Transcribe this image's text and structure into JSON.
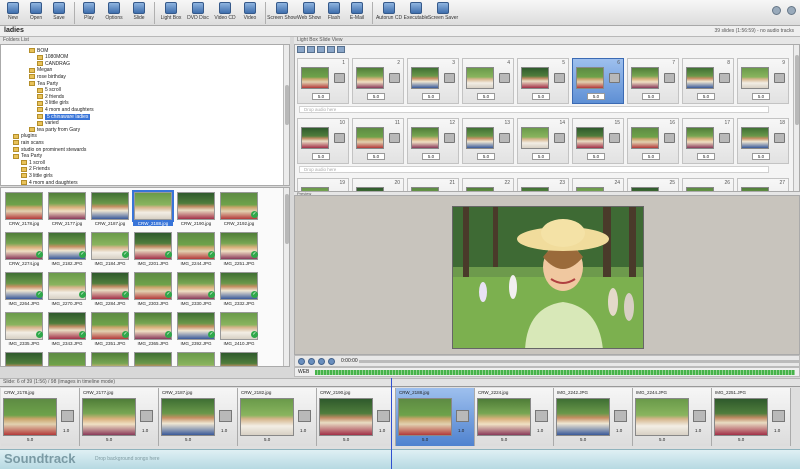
{
  "toolbar": {
    "buttons": [
      "New",
      "Open",
      "Save",
      "Play",
      "Options",
      "Slide",
      "Light Box",
      "DVD Disc",
      "Video CD",
      "Video",
      "Screen Show",
      "Web Show",
      "Flash",
      "E-Mail",
      "Autorun CD",
      "Executable",
      "Screen Saver"
    ]
  },
  "project": {
    "title": "ladies",
    "summary": "39 slides (1:56:59) - no audio tracks"
  },
  "folders": {
    "header": "Folders List",
    "items": [
      {
        "label": "BOM",
        "indent": 3
      },
      {
        "label": "1080MOM",
        "indent": 4
      },
      {
        "label": "CANDRAG",
        "indent": 4
      },
      {
        "label": "Megan",
        "indent": 3
      },
      {
        "label": "rose birthday",
        "indent": 3
      },
      {
        "label": "Tea Party",
        "indent": 3
      },
      {
        "label": "5 scroll",
        "indent": 4
      },
      {
        "label": "2 friends",
        "indent": 4
      },
      {
        "label": "3 little girls",
        "indent": 4
      },
      {
        "label": "4 mom and daughters",
        "indent": 4
      },
      {
        "label": "5 chinaware ladies",
        "indent": 4,
        "selected": true
      },
      {
        "label": "varied",
        "indent": 4
      },
      {
        "label": "tea party from Gary",
        "indent": 3
      },
      {
        "label": "plugins",
        "indent": 1
      },
      {
        "label": "rain scans",
        "indent": 1
      },
      {
        "label": "studio on prominent stewards",
        "indent": 1
      },
      {
        "label": "Tea Party",
        "indent": 1
      },
      {
        "label": "1 scroll",
        "indent": 2
      },
      {
        "label": "2 Friends",
        "indent": 2
      },
      {
        "label": "3 little girls",
        "indent": 2
      },
      {
        "label": "4 mom and daughters",
        "indent": 2
      }
    ]
  },
  "browser": {
    "items": [
      {
        "name": "CRW_2178.jpg",
        "style": "ph-a",
        "checked": false
      },
      {
        "name": "CRW_2177.jpg",
        "style": "ph-b",
        "checked": false
      },
      {
        "name": "CRW_2187.jpg",
        "style": "ph-c",
        "checked": false
      },
      {
        "name": "CRW_2188.jpg",
        "style": "ph-d",
        "checked": false,
        "selected": true
      },
      {
        "name": "CRW_2190.jpg",
        "style": "ph-e",
        "checked": false
      },
      {
        "name": "CRW_2192.jpg",
        "style": "ph-a",
        "checked": true
      },
      {
        "name": "CRW_2274.jpg",
        "style": "ph-b",
        "checked": true
      },
      {
        "name": "IMG_2182.JPG",
        "style": "ph-c",
        "checked": true
      },
      {
        "name": "IMG_2184.JPG",
        "style": "ph-d",
        "checked": true
      },
      {
        "name": "IMG_2201.JPG",
        "style": "ph-e",
        "checked": true
      },
      {
        "name": "IMG_2244.JPG",
        "style": "ph-a",
        "checked": true
      },
      {
        "name": "IMG_2251.JPG",
        "style": "ph-b",
        "checked": true
      },
      {
        "name": "IMG_2264.JPG",
        "style": "ph-c",
        "checked": true
      },
      {
        "name": "IMG_2270.JPG",
        "style": "ph-d",
        "checked": true
      },
      {
        "name": "IMG_2284.JPG",
        "style": "ph-e",
        "checked": true
      },
      {
        "name": "IMG_2303.JPG",
        "style": "ph-a",
        "checked": true
      },
      {
        "name": "IMG_2330.JPG",
        "style": "ph-b",
        "checked": true
      },
      {
        "name": "IMG_2332.JPG",
        "style": "ph-c",
        "checked": true
      },
      {
        "name": "IMG_2335.JPG",
        "style": "ph-d",
        "checked": true
      },
      {
        "name": "IMG_2343.JPG",
        "style": "ph-e",
        "checked": true
      },
      {
        "name": "IMG_2351.JPG",
        "style": "ph-a",
        "checked": true
      },
      {
        "name": "IMG_2365.JPG",
        "style": "ph-b",
        "checked": true
      },
      {
        "name": "IMG_2392.JPG",
        "style": "ph-c",
        "checked": true
      },
      {
        "name": "IMG_2410.JPG",
        "style": "ph-d",
        "checked": true
      },
      {
        "name": "IMG_2411.JPG",
        "style": "ph-e",
        "checked": true
      },
      {
        "name": "IMG_2415.JPG",
        "style": "ph-a",
        "checked": true
      },
      {
        "name": "IMG_2420.JPG",
        "style": "ph-b",
        "checked": true
      },
      {
        "name": "IMG_2436.JPG",
        "style": "ph-c",
        "checked": true
      },
      {
        "name": "IMG_2452.JPG",
        "style": "ph-d",
        "checked": true
      },
      {
        "name": "IMG_2463.JPG",
        "style": "ph-e",
        "checked": true
      },
      {
        "name": "",
        "style": "ph-a",
        "checked": false
      },
      {
        "name": "",
        "style": "ph-b",
        "checked": false
      },
      {
        "name": "",
        "style": "ph-c",
        "checked": false
      },
      {
        "name": "",
        "style": "ph-d",
        "checked": false
      },
      {
        "name": "",
        "style": "ph-e",
        "checked": false
      }
    ]
  },
  "slides": {
    "header": "Light Box Slide View",
    "rows": [
      {
        "numbers": [
          "1",
          "2",
          "3",
          "4",
          "5",
          "6",
          "7",
          "8",
          "9"
        ],
        "durations": [
          "5.0",
          "5.0",
          "5.0",
          "5.0",
          "5.0",
          "5.0",
          "5.0",
          "5.0",
          "5.0"
        ],
        "selected_index": 5
      },
      {
        "numbers": [
          "10",
          "11",
          "12",
          "13",
          "14",
          "15",
          "16",
          "17",
          "18"
        ],
        "durations": [
          "5.0",
          "5.0",
          "5.0",
          "5.0",
          "5.0",
          "5.0",
          "5.0",
          "5.0",
          "5.0"
        ],
        "selected_index": -1
      },
      {
        "numbers": [
          "19",
          "20",
          "21",
          "22",
          "23",
          "24",
          "25",
          "26",
          "27"
        ],
        "durations": [
          "",
          "",
          "",
          "",
          "",
          "",
          "",
          "",
          ""
        ],
        "selected_index": -1
      }
    ],
    "audio_hint": "Drop audio here"
  },
  "preview": {
    "header": "Preview",
    "time": "0:00:00"
  },
  "wave_label": "WEB",
  "status_text": "Slide: 6 of 39 (1:56) / 98 (images in timeline mode)",
  "timeline": {
    "items": [
      {
        "name": "CRW_2178.jpg",
        "style": "ph-a",
        "d1": "5.0",
        "d2": "1.0"
      },
      {
        "name": "CRW_2177.jpg",
        "style": "ph-b",
        "d1": "5.0",
        "d2": "1.0"
      },
      {
        "name": "CRW_2187.jpg",
        "style": "ph-c",
        "d1": "5.0",
        "d2": "1.0"
      },
      {
        "name": "CRW_2182.jpg",
        "style": "ph-d",
        "d1": "5.0",
        "d2": "1.0"
      },
      {
        "name": "CRW_2190.jpg",
        "style": "ph-e",
        "d1": "5.0",
        "d2": "1.0"
      },
      {
        "name": "CRW_2188.jpg",
        "style": "ph-a",
        "d1": "5.0",
        "d2": "1.0",
        "selected": true
      },
      {
        "name": "CRW_2224.jpg",
        "style": "ph-b",
        "d1": "5.0",
        "d2": "1.0"
      },
      {
        "name": "IMG_2242.JPG",
        "style": "ph-c",
        "d1": "5.0",
        "d2": "1.0"
      },
      {
        "name": "IMG_2244.JPG",
        "style": "ph-d",
        "d1": "5.0",
        "d2": "1.0"
      },
      {
        "name": "IMG_2251.JPG",
        "style": "ph-e",
        "d1": "5.0",
        "d2": "1.0"
      }
    ]
  },
  "soundtrack": {
    "label": "Soundtrack",
    "hint": "Drop background songs here"
  },
  "colors": {
    "selection": "#3874d8",
    "check": "#2fa84a",
    "soundtrack_bg": "#c9e4eb"
  }
}
